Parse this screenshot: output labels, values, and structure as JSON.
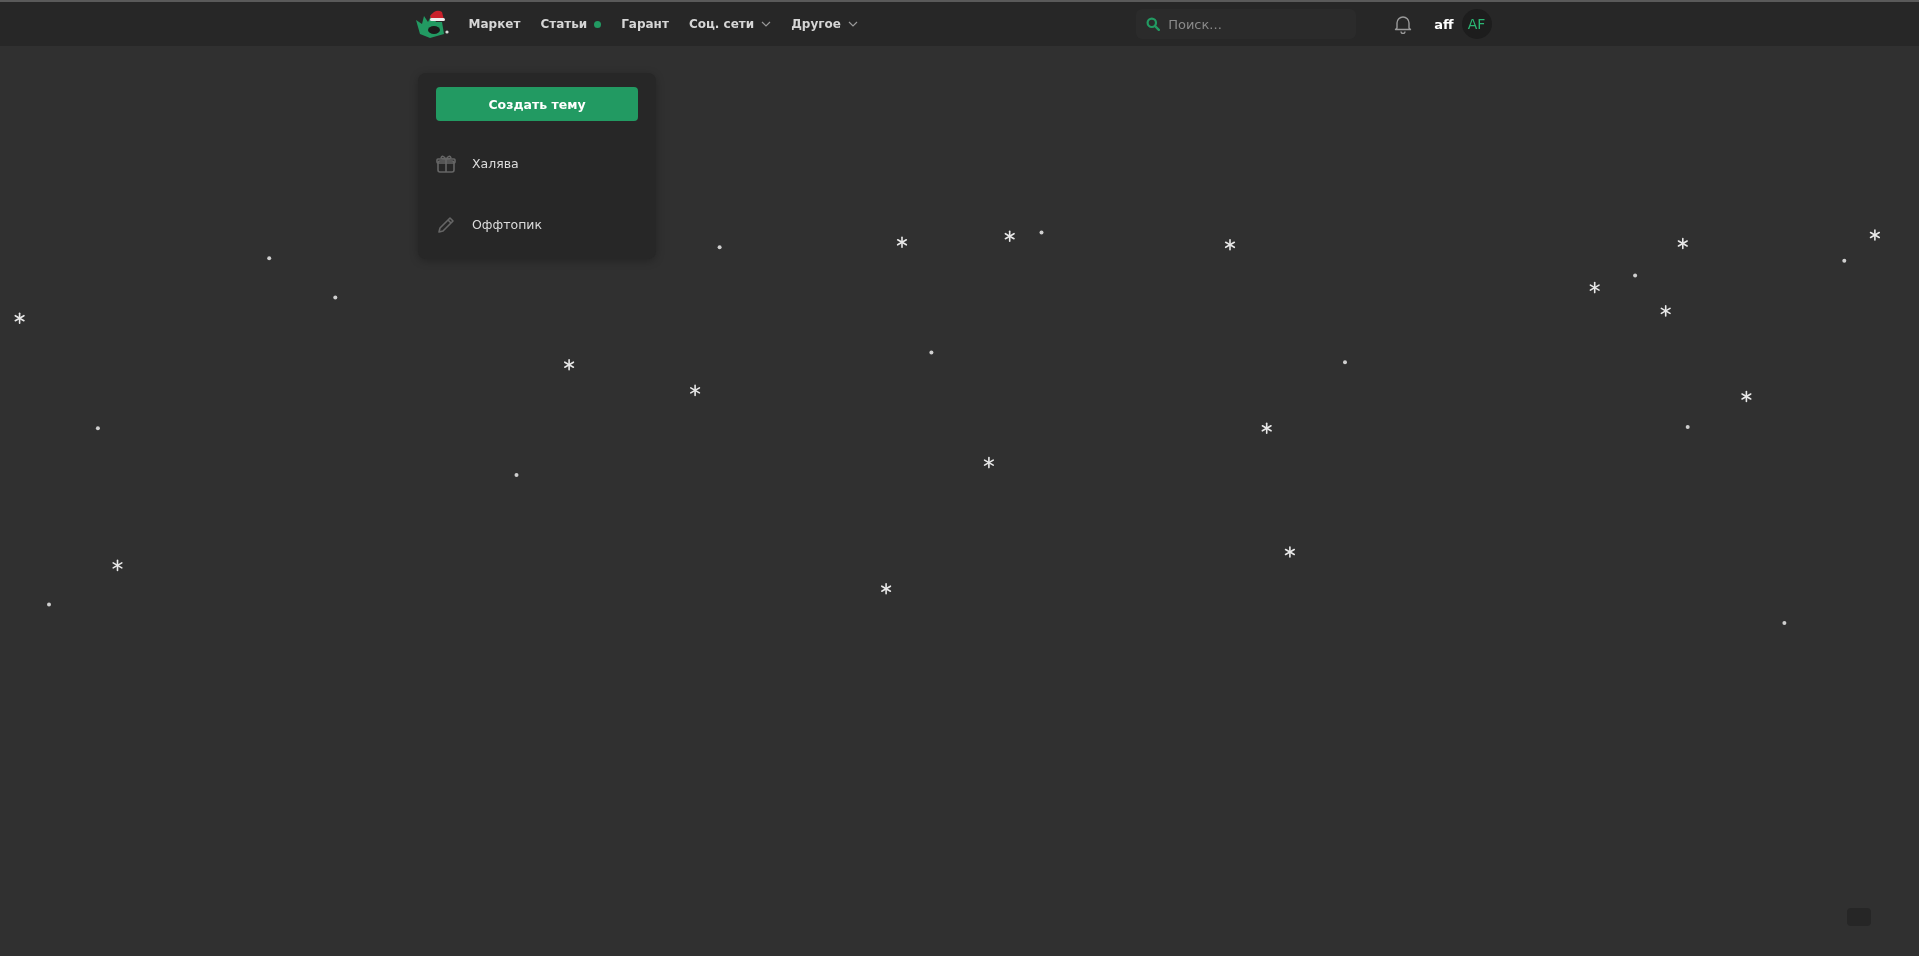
{
  "header": {
    "nav": [
      {
        "label": "Маркет",
        "kind": "plain"
      },
      {
        "label": "Статьи",
        "kind": "dot",
        "color": "#229a62"
      },
      {
        "label": "Гарант",
        "kind": "plain"
      },
      {
        "label": "Соц. сети",
        "kind": "menu"
      },
      {
        "label": "Другое",
        "kind": "menu"
      }
    ],
    "search": {
      "placeholder": "Поиск..."
    },
    "user": {
      "name": "aff",
      "initials": "AF"
    }
  },
  "dropdown": {
    "button": "Создать тему",
    "items": [
      {
        "label": "Халява",
        "kind": "gift"
      },
      {
        "label": "Оффтопик",
        "kind": "pencil"
      }
    ]
  }
}
